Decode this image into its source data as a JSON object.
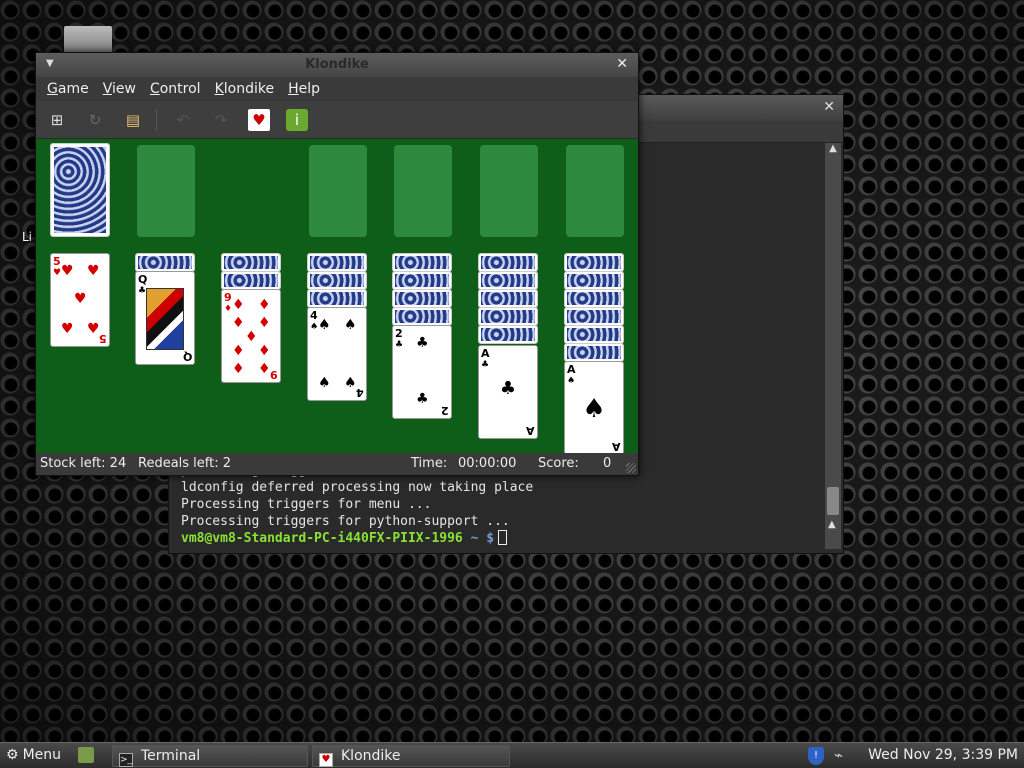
{
  "desktop": {
    "partial_label": "Li"
  },
  "terminal": {
    "lines": [
      "processing triggers for libc-bin ...",
      "ldconfig deferred processing now taking place",
      "Processing triggers for menu ...",
      "Processing triggers for python-support ..."
    ],
    "prompt_user": "vm8@vm8-Standard-PC-i440FX-PIIX-1996",
    "prompt_path": " ~ $"
  },
  "klondike": {
    "title": "Klondike",
    "menu": [
      "Game",
      "View",
      "Control",
      "Klondike",
      "Help"
    ],
    "menu_underline": [
      "G",
      "V",
      "C",
      "K",
      "H"
    ],
    "menu_rest": [
      "ame",
      "iew",
      "ontrol",
      "londike",
      "elp"
    ],
    "toolbar": {
      "new": "new-game-icon",
      "restart": "restart-icon",
      "select": "select-game-icon",
      "undo": "undo-icon",
      "redo": "redo-icon",
      "deal": "deal-icon",
      "hint": "hint-icon"
    },
    "tableau": [
      {
        "rank": "5",
        "suit": "♥",
        "color": "red"
      },
      {
        "rank": "Q",
        "suit": "♣",
        "color": "black"
      },
      {
        "rank": "9",
        "suit": "♦",
        "color": "red"
      },
      {
        "rank": "4",
        "suit": "♠",
        "color": "black"
      },
      {
        "rank": "2",
        "suit": "♣",
        "color": "black"
      },
      {
        "rank": "A",
        "suit": "♣",
        "color": "black"
      },
      {
        "rank": "A",
        "suit": "♠",
        "color": "black"
      }
    ],
    "status": {
      "stock": "Stock left: 24",
      "redeals": "Redeals left: 2",
      "time_label": "Time:",
      "time": "00:00:00",
      "score_label": "Score:",
      "score": "0"
    }
  },
  "taskbar": {
    "menu_label": "Menu",
    "tasks": [
      "Terminal",
      "Klondike"
    ],
    "clock": "Wed Nov 29,  3:39 PM"
  }
}
